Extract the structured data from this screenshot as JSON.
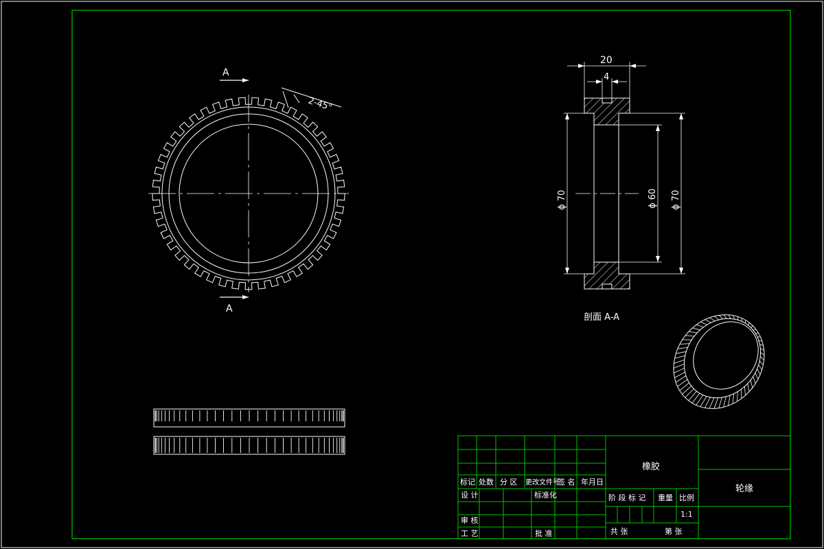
{
  "colors": {
    "background": "#000000",
    "outline": "#ffffff",
    "frame": "#00c800",
    "dimension": "#ffffff"
  },
  "front_view": {
    "section_mark_top": "A",
    "section_mark_bottom": "A",
    "chamfer_note": "2-45°",
    "tooth_count": 45
  },
  "section_view": {
    "dim_width": "20",
    "dim_groove": "4",
    "dim_outer_left": "ϕ 70",
    "dim_inner": "ϕ 60",
    "dim_outer_right": "ϕ 70",
    "caption": "剖面 A-A"
  },
  "title_block": {
    "material": "橡胶",
    "part_name": "轮缘",
    "header_labels": [
      "标记",
      "处数",
      "分 区",
      "更改文件号",
      "签 名",
      "年月日"
    ],
    "design": "设 计",
    "standardization": "标准化",
    "stage_label": "阶 段 标 记",
    "weight_label": "重量",
    "scale_label": "比例",
    "scale_value": "1:1",
    "review": "审 核",
    "process": "工 艺",
    "approve": "批 准",
    "sheet_total": "共  张",
    "sheet_index": "第  张"
  }
}
